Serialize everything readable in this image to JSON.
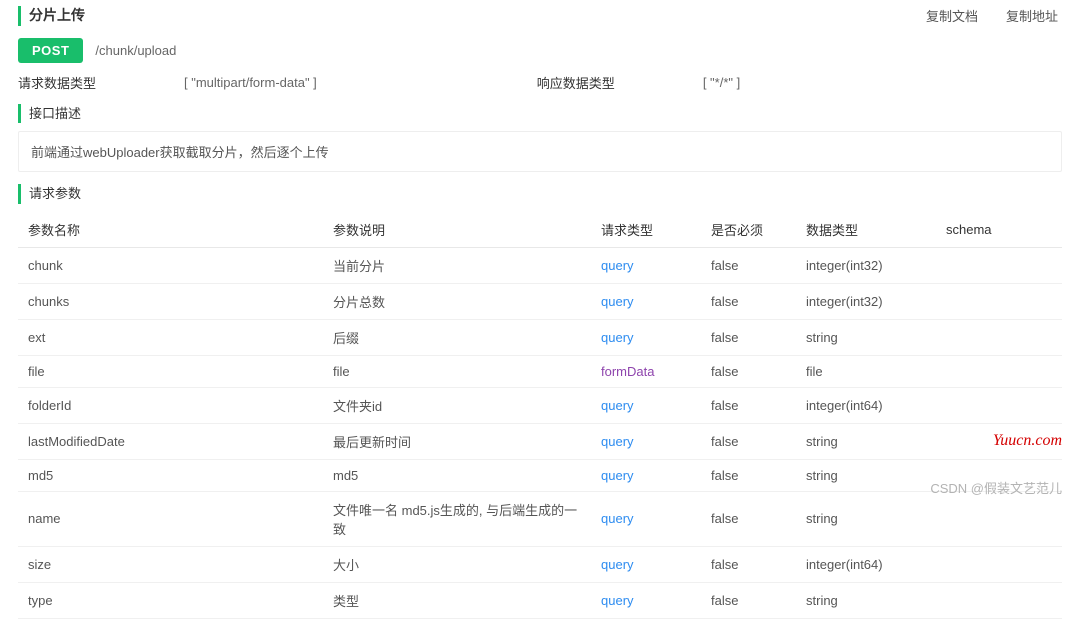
{
  "header": {
    "title": "分片上传",
    "links": {
      "copy_doc": "复制文档",
      "copy_url": "复制地址"
    }
  },
  "endpoint": {
    "method": "POST",
    "path": "/chunk/upload"
  },
  "types": {
    "request_label": "请求数据类型",
    "request_value": "[ \"multipart/form-data\" ]",
    "response_label": "响应数据类型",
    "response_value": "[ \"*/*\" ]"
  },
  "sections": {
    "description_label": "接口描述",
    "description_text": "前端通过webUploader获取截取分片，然后逐个上传",
    "params_label": "请求参数"
  },
  "table": {
    "headers": {
      "name": "参数名称",
      "desc": "参数说明",
      "req_type": "请求类型",
      "required": "是否必须",
      "data_type": "数据类型",
      "schema": "schema"
    },
    "rows": [
      {
        "name": "chunk",
        "desc": "当前分片",
        "req_type": "query",
        "req_class": "link-blue",
        "required": "false",
        "data_type": "integer(int32)",
        "schema": ""
      },
      {
        "name": "chunks",
        "desc": "分片总数",
        "req_type": "query",
        "req_class": "link-blue",
        "required": "false",
        "data_type": "integer(int32)",
        "schema": ""
      },
      {
        "name": "ext",
        "desc": "后缀",
        "req_type": "query",
        "req_class": "link-blue",
        "required": "false",
        "data_type": "string",
        "schema": ""
      },
      {
        "name": "file",
        "desc": "file",
        "req_type": "formData",
        "req_class": "link-purple",
        "required": "false",
        "data_type": "file",
        "schema": ""
      },
      {
        "name": "folderId",
        "desc": "文件夹id",
        "req_type": "query",
        "req_class": "link-blue",
        "required": "false",
        "data_type": "integer(int64)",
        "schema": ""
      },
      {
        "name": "lastModifiedDate",
        "desc": "最后更新时间",
        "req_type": "query",
        "req_class": "link-blue",
        "required": "false",
        "data_type": "string",
        "schema": ""
      },
      {
        "name": "md5",
        "desc": "md5",
        "req_type": "query",
        "req_class": "link-blue",
        "required": "false",
        "data_type": "string",
        "schema": ""
      },
      {
        "name": "name",
        "desc": "文件唯一名 md5.js生成的, 与后端生成的一致",
        "req_type": "query",
        "req_class": "link-blue",
        "required": "false",
        "data_type": "string",
        "schema": ""
      },
      {
        "name": "size",
        "desc": "大小",
        "req_type": "query",
        "req_class": "link-blue",
        "required": "false",
        "data_type": "integer(int64)",
        "schema": ""
      },
      {
        "name": "type",
        "desc": "类型",
        "req_type": "query",
        "req_class": "link-blue",
        "required": "false",
        "data_type": "string",
        "schema": ""
      }
    ]
  },
  "watermarks": {
    "w1": "Yuucn.com",
    "w2": "CSDN @假装文艺范儿"
  }
}
